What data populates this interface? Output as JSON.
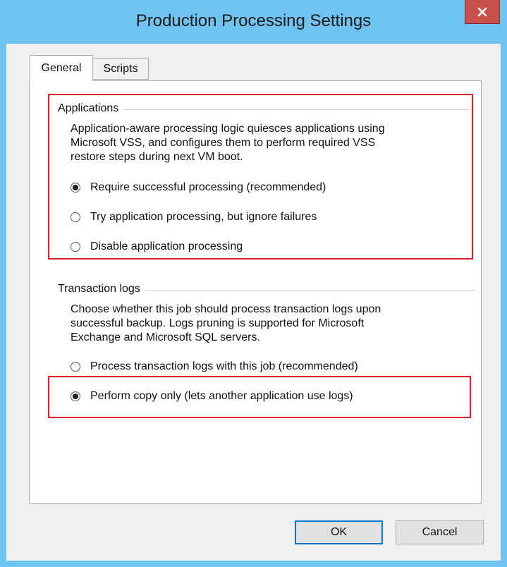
{
  "window": {
    "title": "Production Processing Settings",
    "close_label": "x"
  },
  "tabs": [
    {
      "label": "General",
      "selected": true
    },
    {
      "label": "Scripts",
      "selected": false
    }
  ],
  "applications": {
    "title": "Applications",
    "description_lines": [
      "Application-aware processing logic quiesces applications using",
      "Microsoft VSS, and configures them to perform required VSS",
      "restore steps during next VM boot."
    ],
    "options": [
      {
        "label": "Require successful processing  (recommended)",
        "checked": true
      },
      {
        "label": "Try application processing, but ignore failures",
        "checked": false
      },
      {
        "label": "Disable application processing",
        "checked": false
      }
    ]
  },
  "transaction_logs": {
    "title": "Transaction logs",
    "description_lines": [
      "Choose whether this job should process transaction logs upon",
      "successful backup. Logs pruning is supported for Microsoft",
      "Exchange and Microsoft SQL servers."
    ],
    "options": [
      {
        "label": "Process transaction logs with this job (recommended)",
        "checked": false
      },
      {
        "label": "Perform copy only (lets another application use logs)",
        "checked": true
      }
    ]
  },
  "buttons": {
    "ok": "OK",
    "cancel": "Cancel"
  },
  "colors": {
    "frame": "#6fc3f0",
    "close": "#c7504a",
    "highlight": "#e0202a"
  }
}
